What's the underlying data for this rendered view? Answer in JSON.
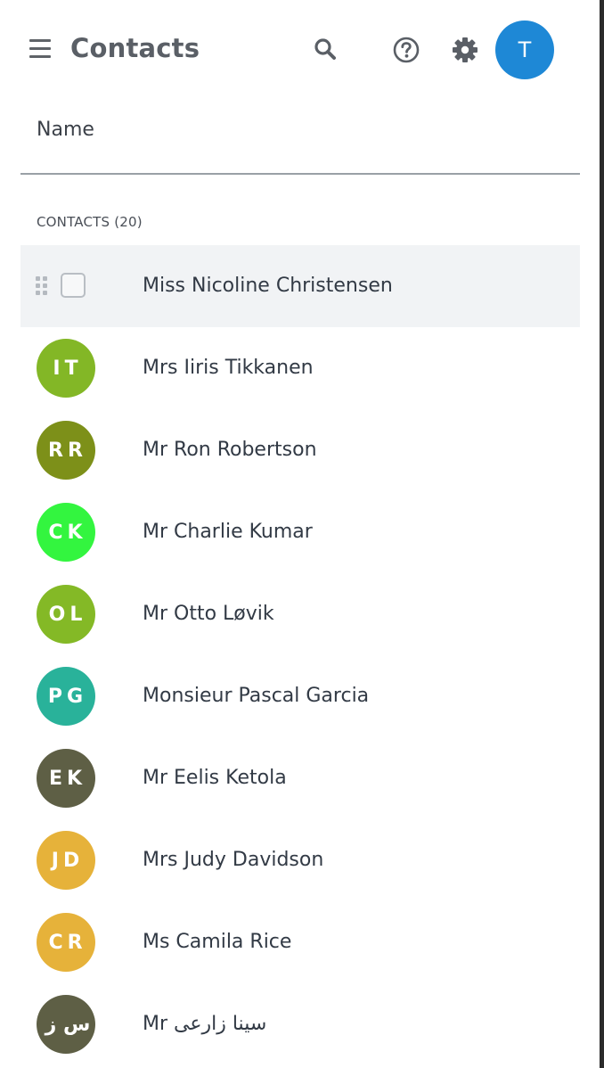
{
  "header": {
    "title": "Contacts",
    "user_initial": "T",
    "avatar_color": "#1e88d6"
  },
  "icons": {
    "menu": "hamburger-menu-icon",
    "search": "search-icon",
    "help": "help-circle-icon",
    "settings": "gear-icon",
    "drag": "drag-handle-icon"
  },
  "name_field": {
    "label": "Name"
  },
  "contacts": {
    "section_label": "CONTACTS (20)",
    "items": [
      {
        "name": "Miss Nicoline Christensen",
        "initials": "",
        "color": "",
        "selected": true
      },
      {
        "name": "Mrs Iiris Tikkanen",
        "initials": "IT",
        "color": "#83b726"
      },
      {
        "name": "Mr Ron Robertson",
        "initials": "RR",
        "color": "#7d9019"
      },
      {
        "name": "Mr Charlie Kumar",
        "initials": "CK",
        "color": "#33f53f"
      },
      {
        "name": "Mr Otto Løvik",
        "initials": "OL",
        "color": "#84b926"
      },
      {
        "name": "Monsieur Pascal Garcia",
        "initials": "PG",
        "color": "#29b29a"
      },
      {
        "name": "Mr Eelis Ketola",
        "initials": "EK",
        "color": "#5e5f45"
      },
      {
        "name": "Mrs Judy Davidson",
        "initials": "JD",
        "color": "#e6b23a"
      },
      {
        "name": "Ms Camila Rice",
        "initials": "CR",
        "color": "#e6b23a"
      },
      {
        "name": "Mr سینا زارعی",
        "initials": "س ز",
        "color": "#5e5f45"
      }
    ]
  }
}
